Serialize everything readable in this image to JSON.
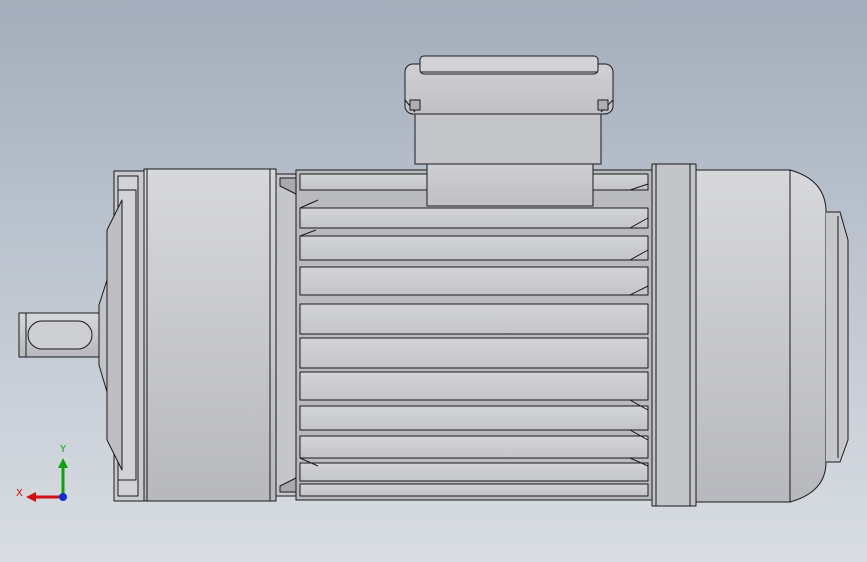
{
  "viewport": {
    "colors": {
      "background_top": "#a3adbb",
      "background_bottom": "#d9dde3",
      "part_face": "#c8c9cd",
      "part_light": "#dcdde0",
      "part_shadow": "#9fa1a6",
      "edge": "#1a1a1a"
    }
  },
  "model": {
    "name": "motor-assembly"
  },
  "triad": {
    "x_label": "X",
    "y_label": "Y",
    "colors": {
      "x": "#d01010",
      "y": "#10a010",
      "z": "#1030d0"
    }
  }
}
